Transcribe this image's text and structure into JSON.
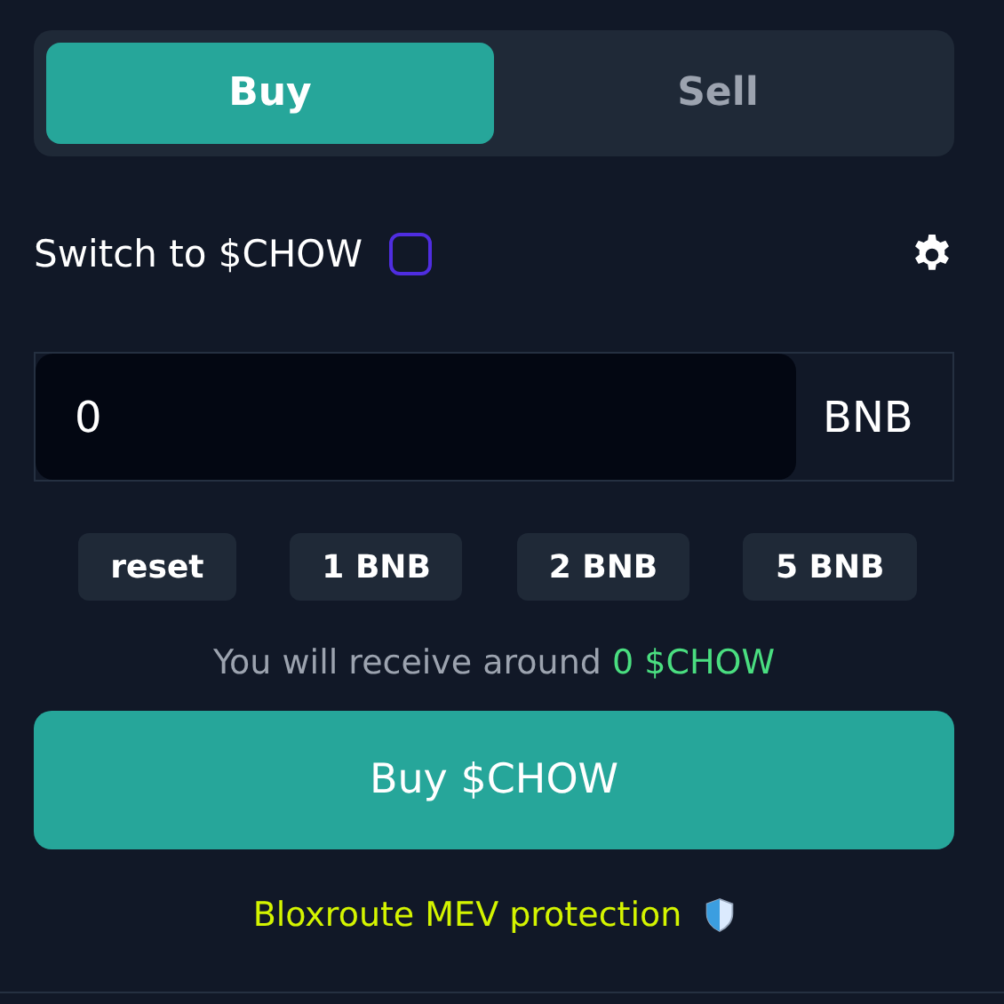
{
  "tabs": [
    {
      "label": "Buy",
      "selected": true
    },
    {
      "label": "Sell",
      "selected": false
    }
  ],
  "switch": {
    "label": "Switch to $CHOW",
    "checked": false
  },
  "amount": {
    "value": "0",
    "unit": "BNB"
  },
  "presets": [
    "reset",
    "1 BNB",
    "2 BNB",
    "5 BNB"
  ],
  "receive": {
    "prefix": "You will receive around",
    "amount": "0 $CHOW"
  },
  "action_button": "Buy $CHOW",
  "protection_note": "Bloxroute MEV protection"
}
